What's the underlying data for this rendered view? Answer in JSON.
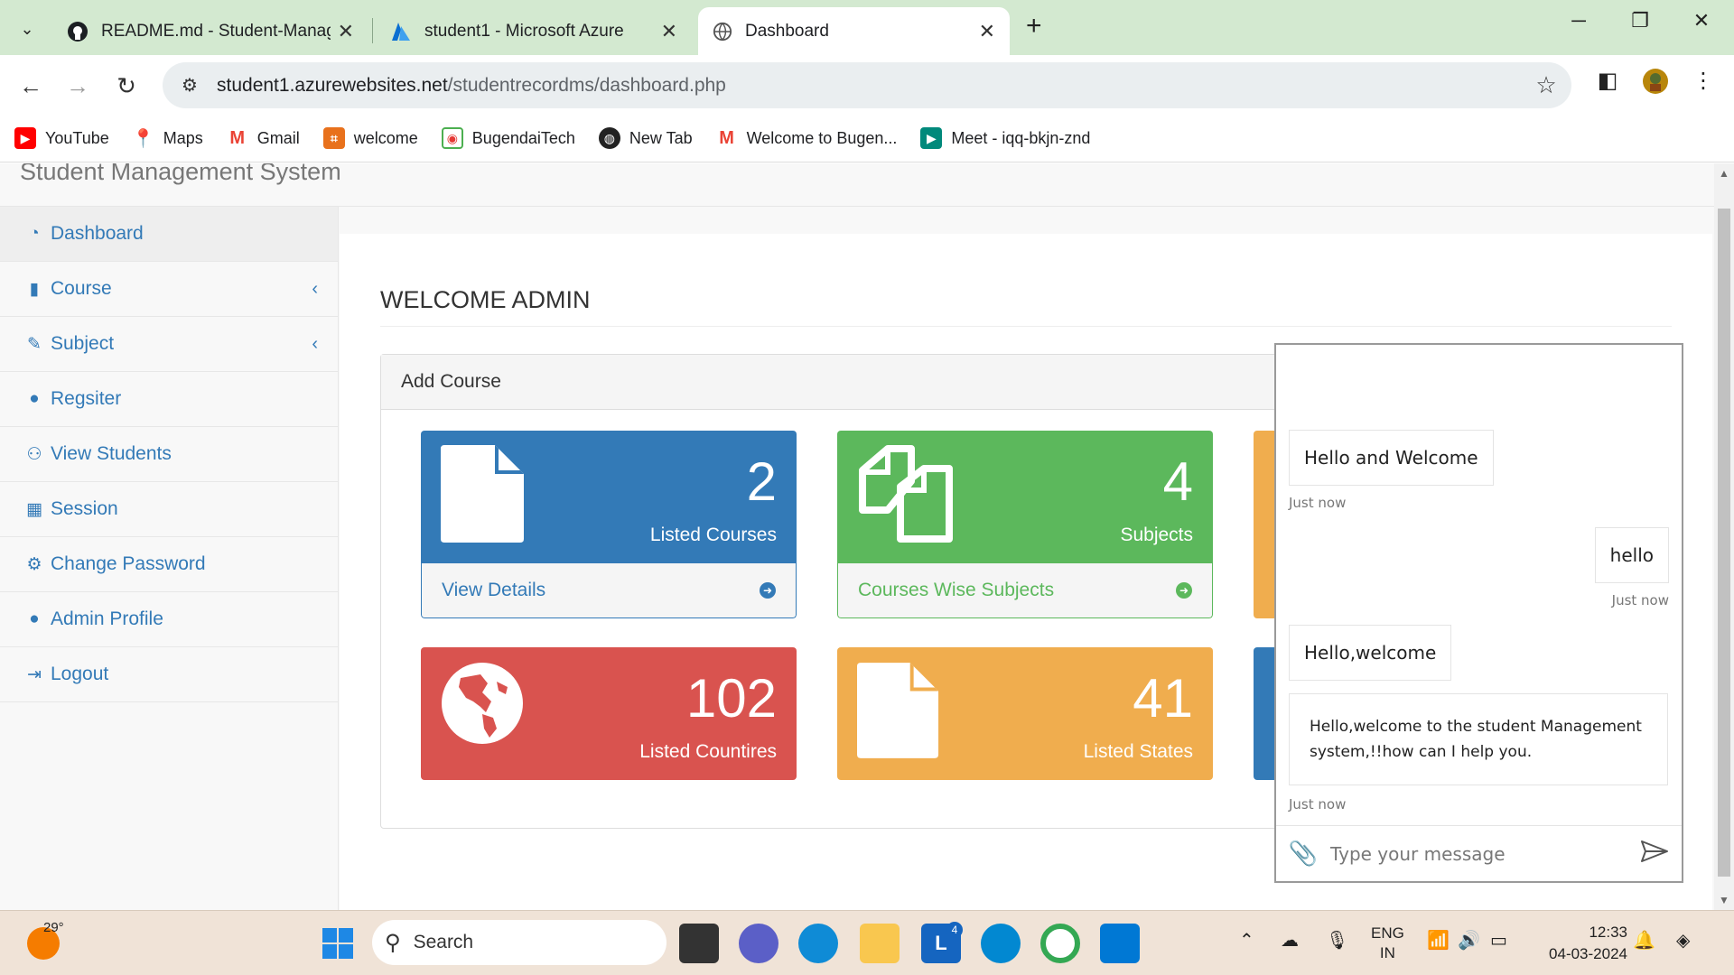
{
  "browser": {
    "tabs": [
      {
        "title": "README.md - Student-Management",
        "icon": "github-icon"
      },
      {
        "title": "student1 - Microsoft Azure",
        "icon": "azure-icon"
      },
      {
        "title": "Dashboard",
        "icon": "globe-icon"
      }
    ],
    "url_host": "student1.azurewebsites.net",
    "url_path": "/studentrecordms/dashboard.php",
    "bookmarks": [
      "YouTube",
      "Maps",
      "Gmail",
      "welcome",
      "BugendaiTech",
      "New Tab",
      "Welcome to Bugen...",
      "Meet - iqq-bkjn-znd"
    ]
  },
  "app": {
    "brand": "Student Management System",
    "sidebar": [
      {
        "label": "Dashboard",
        "icon": "dashboard-icon"
      },
      {
        "label": "Course",
        "icon": "file-icon",
        "arrow": "‹"
      },
      {
        "label": "Subject",
        "icon": "edit-icon",
        "arrow": "‹"
      },
      {
        "label": "Regsiter",
        "icon": "user-icon"
      },
      {
        "label": "View Students",
        "icon": "users-icon"
      },
      {
        "label": "Session",
        "icon": "calendar-icon"
      },
      {
        "label": "Change Password",
        "icon": "gear-icon"
      },
      {
        "label": "Admin Profile",
        "icon": "user-icon"
      },
      {
        "label": "Logout",
        "icon": "sign-out-icon"
      }
    ],
    "welcome": "WELCOME ADMIN",
    "panel_title": "Add Course",
    "cards": [
      {
        "count": "2",
        "label": "Listed Courses",
        "footer": "View Details",
        "color": "#337ab7"
      },
      {
        "count": "4",
        "label": "Subjects",
        "footer": "Courses Wise Subjects",
        "color": "#5cb85c"
      },
      {
        "count": "102",
        "label": "Listed Countires",
        "color": "#d9534f"
      },
      {
        "count": "41",
        "label": "Listed States",
        "color": "#f0ad4e"
      }
    ]
  },
  "chat": {
    "messages": [
      {
        "text": "Hello and Welcome",
        "time": "Just now",
        "side": "left"
      },
      {
        "text": "hello",
        "time": "Just now",
        "side": "right"
      },
      {
        "text": "Hello,welcome",
        "side": "left"
      },
      {
        "text": "Hello,welcome to the student Management system,!!how can I help you.",
        "time": "Just now",
        "side": "left"
      }
    ],
    "placeholder": "Type your message"
  },
  "taskbar": {
    "weather": "29°",
    "search": "Search",
    "badge": "4",
    "lang1": "ENG",
    "lang2": "IN",
    "time": "12:33",
    "date": "04-03-2024"
  }
}
